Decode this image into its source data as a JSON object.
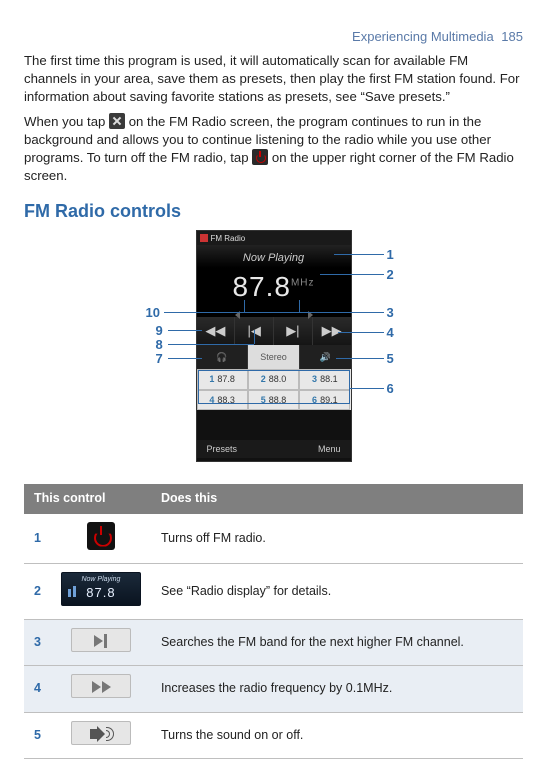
{
  "header": {
    "title": "Experiencing Multimedia",
    "page": "185"
  },
  "intro": {
    "p1": "The first time this program is used, it will automatically scan for available FM channels in your area, save them as presets, then play the first FM station found. For information about saving favorite stations as presets, see “Save presets.”",
    "p2a": "When you tap ",
    "p2b": " on the FM Radio screen, the program continues to run in the background and allows you to continue listening to the radio while you use other programs. To turn off the FM radio, tap ",
    "p2c": " on the upper right corner of the FM Radio screen."
  },
  "section_title": "FM Radio controls",
  "radio_ui": {
    "app_title": "FM Radio",
    "now_playing": "Now Playing",
    "frequency": "87.8",
    "unit": "MHz",
    "mode_label": "Stereo",
    "presets": [
      {
        "n": "1",
        "f": "87.8"
      },
      {
        "n": "2",
        "f": "88.0"
      },
      {
        "n": "3",
        "f": "88.1"
      },
      {
        "n": "4",
        "f": "88.3"
      },
      {
        "n": "5",
        "f": "88.8"
      },
      {
        "n": "6",
        "f": "89.1"
      }
    ],
    "softkeys": {
      "left": "Presets",
      "right": "Menu"
    }
  },
  "callouts": {
    "n1": "1",
    "n2": "2",
    "n3": "3",
    "n4": "4",
    "n5": "5",
    "n6": "6",
    "n7": "7",
    "n8": "8",
    "n9": "9",
    "n10": "10"
  },
  "table": {
    "head": {
      "col1": "This control",
      "col2": "Does this"
    },
    "rows": [
      {
        "num": "1",
        "desc": "Turns off FM radio."
      },
      {
        "num": "2",
        "desc": "See “Radio display” for details."
      },
      {
        "num": "3",
        "desc": "Searches the FM band for the next higher FM channel."
      },
      {
        "num": "4",
        "desc": "Increases the radio frequency by 0.1MHz."
      },
      {
        "num": "5",
        "desc": "Turns the sound on or off."
      }
    ],
    "display_icon": {
      "np": "Now Playing",
      "freq": "87.8"
    }
  }
}
